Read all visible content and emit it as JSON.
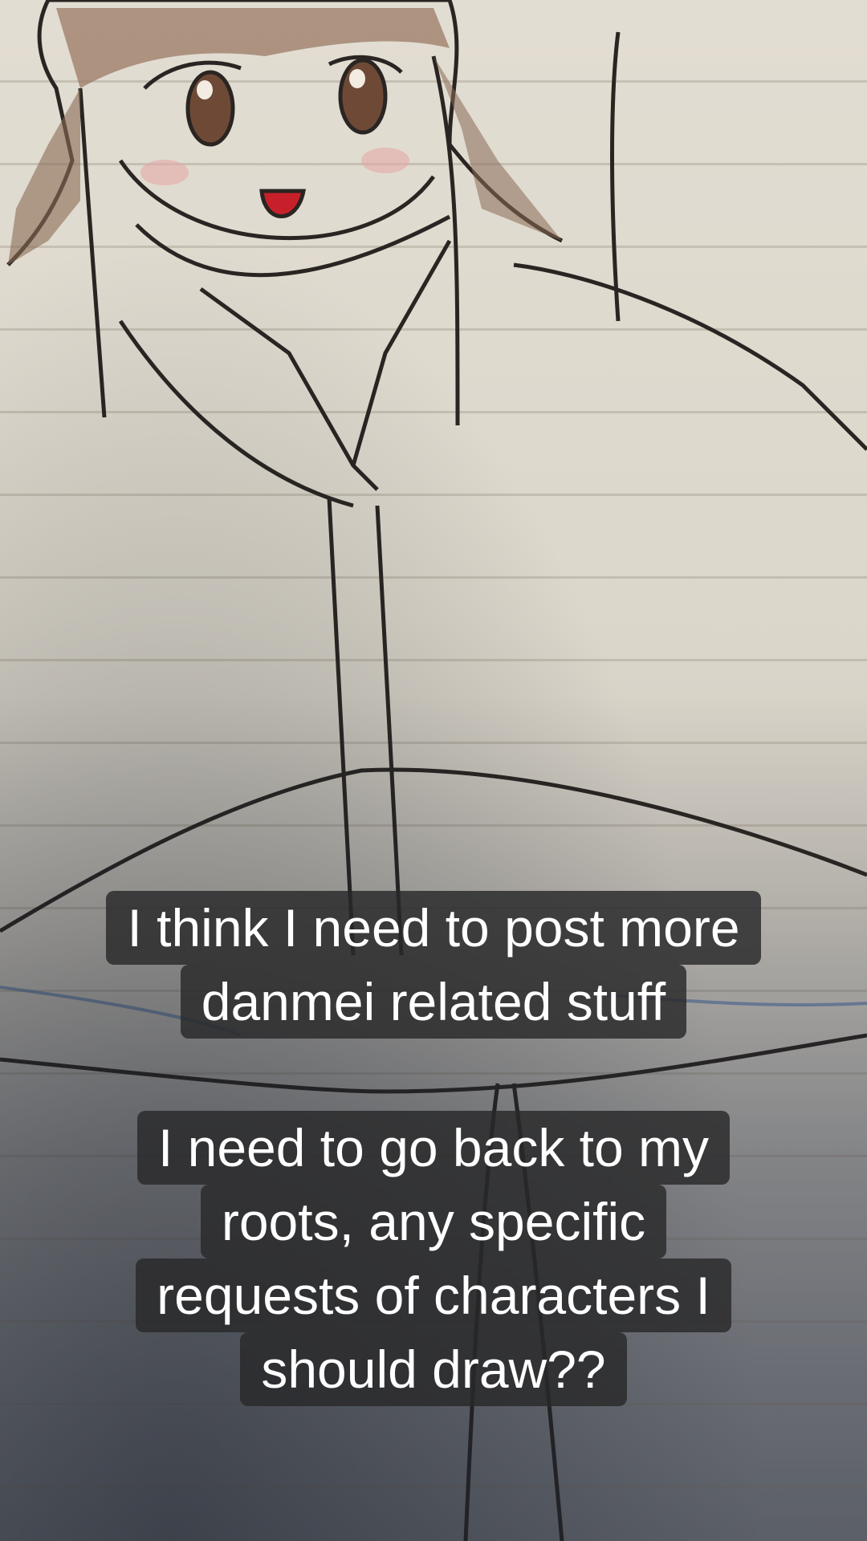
{
  "captions": [
    {
      "lines": [
        "I think I need to post more",
        "danmei related stuff"
      ]
    },
    {
      "lines": [
        "I need to go back to my",
        "roots, any specific",
        "requests of characters I",
        "should draw??"
      ]
    }
  ],
  "colors": {
    "paper": "#e2ddd2",
    "ink": "#2a2522",
    "hair": "#8a6a55",
    "mouth": "#c8202a",
    "caption_bg": "#28282a",
    "caption_text": "#ffffff"
  }
}
